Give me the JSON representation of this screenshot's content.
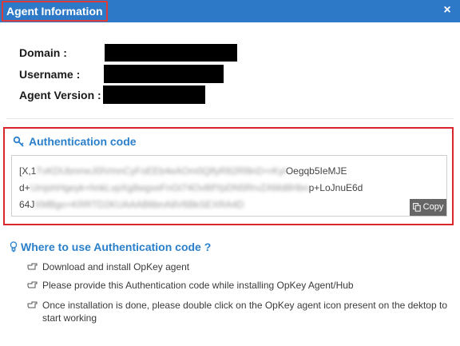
{
  "window": {
    "title": "Agent Information",
    "close_label": "×"
  },
  "info": {
    "domain_label": "Domain :",
    "username_label": "Username :",
    "agent_version_label": "Agent Version :"
  },
  "auth": {
    "header": "Authentication code",
    "code_line1_start": "[X,1",
    "code_line1_end": "Oegqb5IeMJE",
    "code_line2_start": "d+",
    "code_line2_end": "p+LoJnuE6d",
    "code_line3_start": "64J",
    "copy_label": "Copy"
  },
  "where": {
    "header": "Where to use Authentication code ?",
    "instructions": [
      "Download and install OpKey agent",
      "Please provide this Authentication code while installing OpKey Agent/Hub",
      "Once installation is done, please double click on the OpKey agent icon present on the dektop to start working"
    ]
  },
  "colors": {
    "title_bar": "#2d78c7",
    "accent_blue": "#2a7fca",
    "highlight_red": "#d9252c",
    "copy_button": "#666666"
  }
}
